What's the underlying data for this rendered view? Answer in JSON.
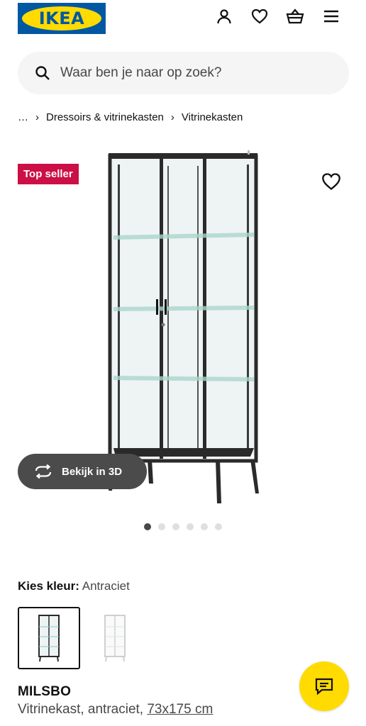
{
  "header": {
    "logo_text": "IKEA",
    "icons": [
      "account-icon",
      "heart-icon",
      "basket-icon",
      "menu-icon"
    ]
  },
  "search": {
    "placeholder": "Waar ben je naar op zoek?"
  },
  "breadcrumb": {
    "ellipsis": "…",
    "items": [
      "Dressoirs & vitrinekasten",
      "Vitrinekasten"
    ]
  },
  "product": {
    "badge": "Top seller",
    "view_3d_label": "Bekijk in 3D",
    "image_count": 6,
    "active_image": 1,
    "color_label": "Kies kleur:",
    "color_value": "Antraciet",
    "name": "MILSBO",
    "description": "Vitrinekast, antraciet,",
    "size": "73x175 cm"
  },
  "colors": {
    "brand_blue": "#0058a3",
    "brand_yellow": "#ffdb00",
    "badge_red": "#cc0f45",
    "button_dark": "#4b4b4b"
  }
}
